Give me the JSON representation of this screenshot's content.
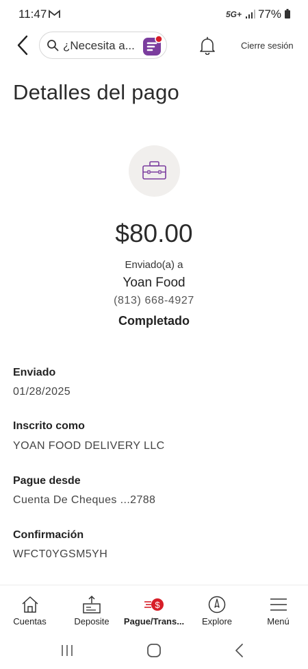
{
  "status_bar": {
    "time": "11:47",
    "network": "5G+",
    "battery": "77%"
  },
  "nav": {
    "search_placeholder": "¿Necesita a...",
    "logout_label": "Cierre sesión"
  },
  "page": {
    "title": "Detalles del pago"
  },
  "payment": {
    "amount": "$80.00",
    "sent_to_label": "Enviado(a) a",
    "recipient_name": "Yoan Food",
    "recipient_phone": "(813) 668-4927",
    "status": "Completado"
  },
  "details": [
    {
      "label": "Enviado",
      "value": "01/28/2025"
    },
    {
      "label": "Inscrito como",
      "value": "YOAN FOOD DELIVERY LLC"
    },
    {
      "label": "Pague desde",
      "value": "Cuenta De Cheques ...2788"
    },
    {
      "label": "Confirmación",
      "value": "WFCT0YGSM5YH"
    }
  ],
  "tabs": [
    {
      "label": "Cuentas",
      "icon": "home-icon",
      "active": false
    },
    {
      "label": "Deposite",
      "icon": "deposit-icon",
      "active": false
    },
    {
      "label": "Pague/Trans...",
      "icon": "pay-transfer-icon",
      "active": true
    },
    {
      "label": "Explore",
      "icon": "compass-icon",
      "active": false
    },
    {
      "label": "Menú",
      "icon": "menu-icon",
      "active": false
    }
  ],
  "colors": {
    "accent_purple": "#7b3d9e",
    "brand_red": "#d71e28",
    "icon_circle_bg": "#f1efed"
  }
}
